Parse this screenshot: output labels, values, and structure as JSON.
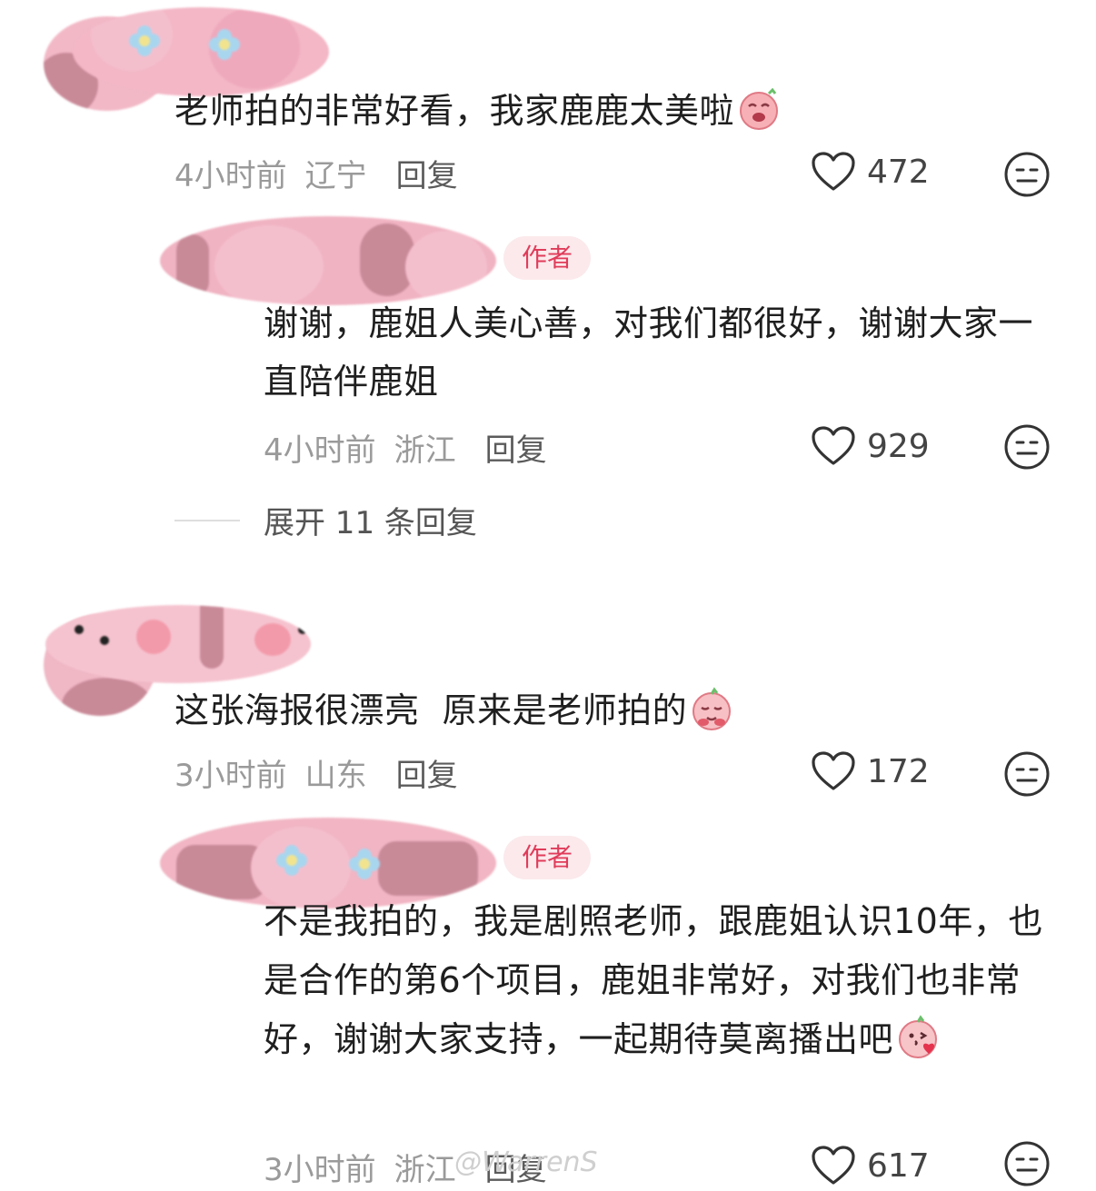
{
  "comments": [
    {
      "text": "老师拍的非常好看，我家鹿鹿太美啦",
      "time": "4小时前",
      "location": "辽宁",
      "reply_label": "回复",
      "likes": "472",
      "reply": {
        "badge": "作者",
        "text": "谢谢，鹿姐人美心善，对我们都很好，谢谢大家一直陪伴鹿姐",
        "time": "4小时前",
        "location": "浙江",
        "reply_label": "回复",
        "likes": "929"
      },
      "expand_label": "展开 11 条回复"
    },
    {
      "text": "这张海报很漂亮  原来是老师拍的",
      "time": "3小时前",
      "location": "山东",
      "reply_label": "回复",
      "likes": "172",
      "reply": {
        "badge": "作者",
        "text": "不是我拍的，我是剧照老师，跟鹿姐认识10年，也是合作的第6个项目，鹿姐非常好，对我们也非常好，谢谢大家支持，一起期待莫离播出吧",
        "time": "3小时前",
        "location": "浙江",
        "reply_label": "回复",
        "likes": "617"
      }
    }
  ],
  "watermark": "@WarrenS",
  "colors": {
    "badge_bg": "#fbe9ec",
    "badge_text": "#e03c5a",
    "avatar_pink": "#efa9bd"
  },
  "icons": [
    "heart-outline-icon",
    "dislike-face-icon",
    "crying-emoji-icon",
    "shy-emoji-icon",
    "kiss-emoji-icon",
    "flower-icon"
  ]
}
